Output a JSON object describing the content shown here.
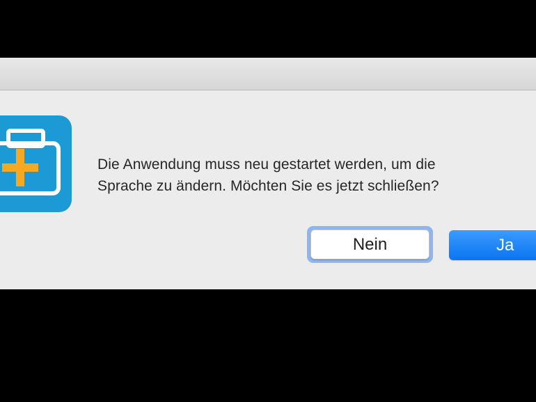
{
  "dialog": {
    "icon": "first-aid-kit-icon",
    "message_line1": "Die Anwendung muss neu gestartet werden, um die",
    "message_line2": "Sprache zu ändern. Möchten Sie es jetzt schließen?",
    "no_label": "Nein",
    "yes_label": "Ja"
  },
  "colors": {
    "icon_bg": "#1b9ad6",
    "icon_cross": "#f7a823",
    "accent": "#0a75f0",
    "dialog_bg": "#ececec"
  }
}
